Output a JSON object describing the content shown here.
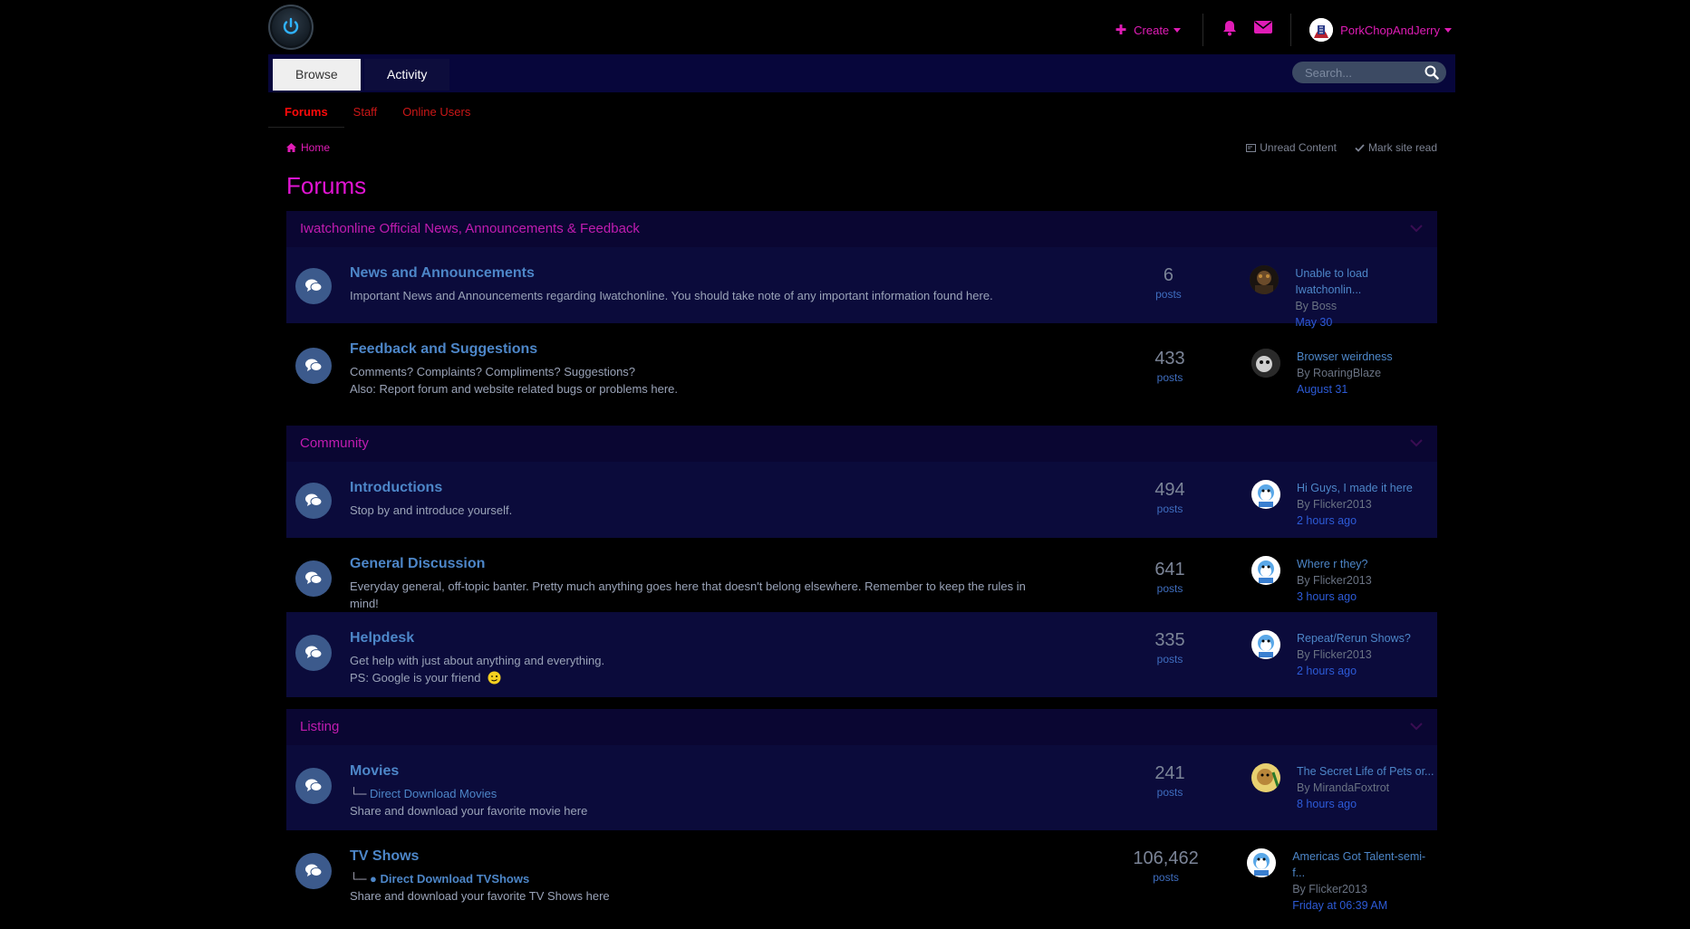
{
  "header": {
    "create_label": "Create",
    "username": "PorkChopAndJerry"
  },
  "nav": {
    "tabs": [
      {
        "label": "Browse"
      },
      {
        "label": "Activity"
      }
    ],
    "search_placeholder": "Search..."
  },
  "subnav": {
    "items": [
      {
        "label": "Forums"
      },
      {
        "label": "Staff"
      },
      {
        "label": "Online Users"
      }
    ]
  },
  "breadcrumb": {
    "home": "Home",
    "unread": "Unread Content",
    "mark_read": "Mark site read"
  },
  "page_title": "Forums",
  "categories": [
    {
      "title": "Iwatchonline Official News, Announcements & Feedback",
      "forums": [
        {
          "title": "News and Announcements",
          "desc": "Important News and Announcements regarding Iwatchonline. You should take note of any important information found here.",
          "posts": "6",
          "posts_label": "posts",
          "last_title": "Unable to load Iwatchonlin...",
          "last_by": "By Boss",
          "last_when": "May 30"
        },
        {
          "title": "Feedback and Suggestions",
          "desc": "Comments? Complaints? Compliments? Suggestions?",
          "desc2": "Also: Report forum and website related bugs or problems here.",
          "posts": "433",
          "posts_label": "posts",
          "last_title": "Browser weirdness",
          "last_by": "By RoaringBlaze",
          "last_when": "August 31"
        }
      ]
    },
    {
      "title": "Community",
      "forums": [
        {
          "title": "Introductions",
          "desc": "Stop by and introduce yourself.",
          "posts": "494",
          "posts_label": "posts",
          "last_title": "Hi Guys, I made it here",
          "last_by": "By Flicker2013",
          "last_when": "2 hours ago"
        },
        {
          "title": "General Discussion",
          "desc": "Everyday general, off-topic banter. Pretty much anything goes here that doesn't belong elsewhere. Remember to keep the rules in mind!",
          "posts": "641",
          "posts_label": "posts",
          "last_title": "Where r they?",
          "last_by": "By Flicker2013",
          "last_when": "3 hours ago"
        },
        {
          "title": "Helpdesk",
          "desc": "Get help with just about anything and everything.",
          "desc2": "PS: Google is your friend",
          "posts": "335",
          "posts_label": "posts",
          "last_title": "Repeat/Rerun Shows?",
          "last_by": "By Flicker2013",
          "last_when": "2 hours ago"
        }
      ]
    },
    {
      "title": "Listing",
      "forums": [
        {
          "title": "Movies",
          "sub": "Direct Download Movies",
          "desc": "Share and download your favorite movie here",
          "posts": "241",
          "posts_label": "posts",
          "last_title": "The Secret Life of Pets or...",
          "last_by": "By MirandaFoxtrot",
          "last_when": "8 hours ago"
        },
        {
          "title": "TV Shows",
          "sub": "Direct Download TVShows",
          "desc": "Share and download your favorite TV Shows here",
          "posts": "106,462",
          "posts_label": "posts",
          "last_title": "Americas Got Talent-semi-f...",
          "last_by": "By Flicker2013",
          "last_when": "Friday at 06:39 AM"
        }
      ]
    }
  ],
  "colors": {
    "accent": "#e01cb6",
    "nav_bg": "#07063b",
    "row_alt": "#0b0b3b",
    "link": "#4d86c8"
  }
}
